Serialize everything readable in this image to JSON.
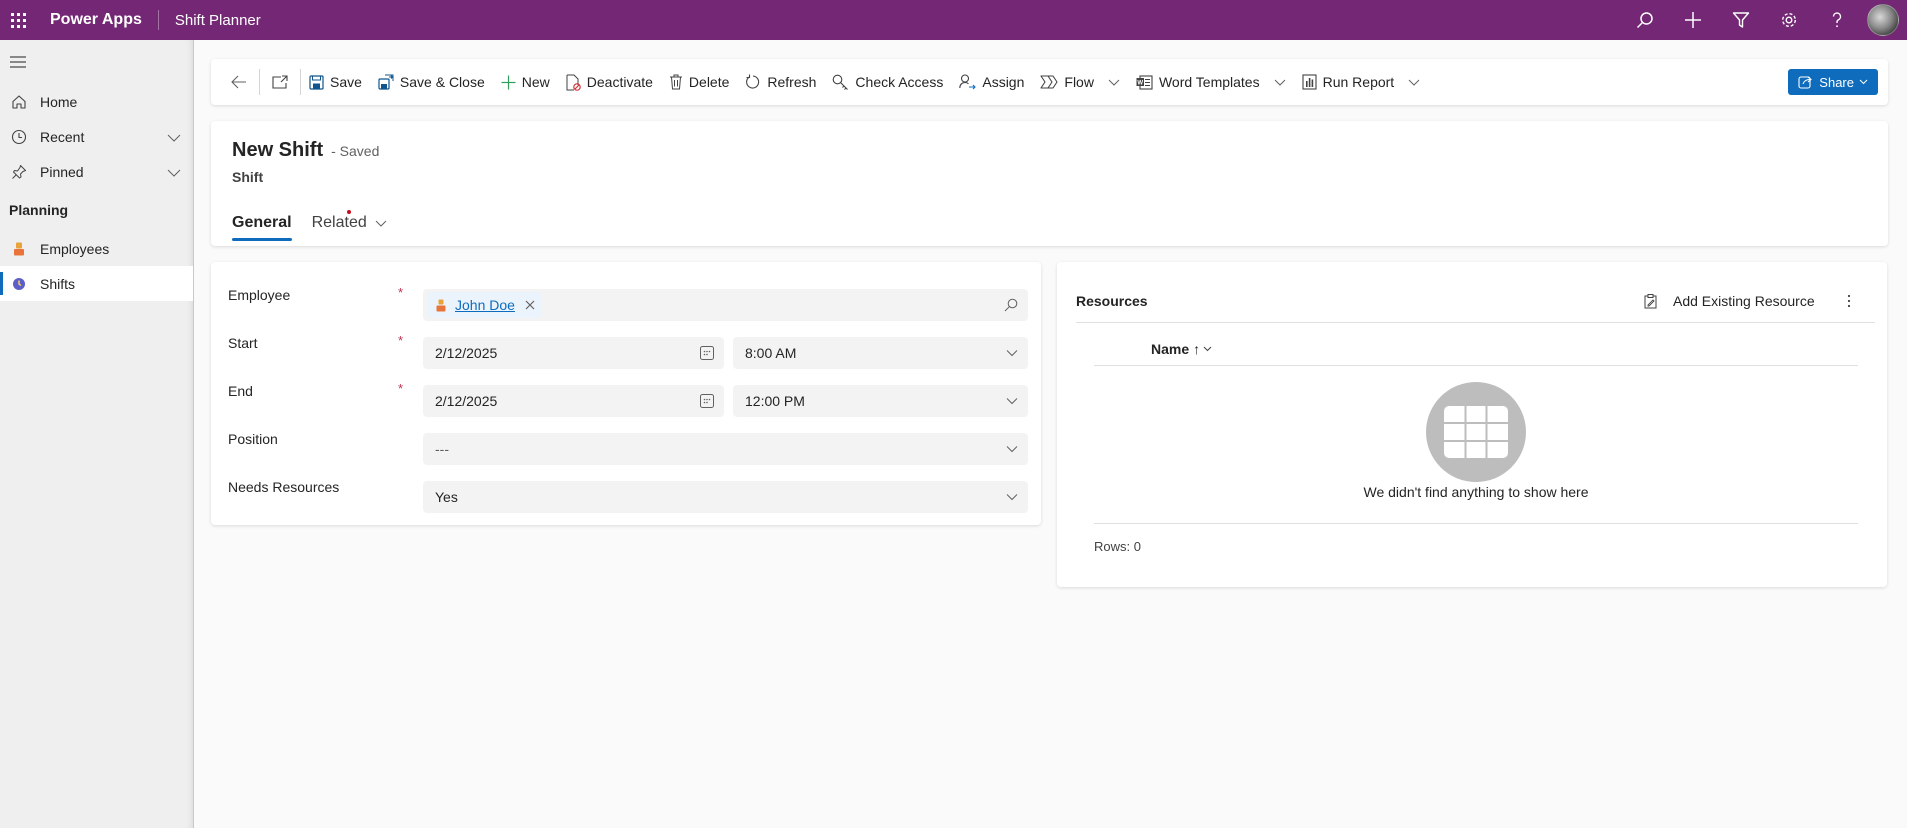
{
  "topbar": {
    "app_name": "Power Apps",
    "app_title": "Shift Planner",
    "icons": [
      "search-icon",
      "plus-icon",
      "filter-icon",
      "settings-icon",
      "help-icon"
    ],
    "brand_color": "#742774"
  },
  "sidebar": {
    "items": [
      {
        "label": "Home",
        "icon": "home-icon"
      },
      {
        "label": "Recent",
        "icon": "clock-icon",
        "expandable": true
      },
      {
        "label": "Pinned",
        "icon": "pin-icon",
        "expandable": true
      }
    ],
    "group_label": "Planning",
    "group_items": [
      {
        "label": "Employees",
        "icon": "employee-icon",
        "selected": false
      },
      {
        "label": "Shifts",
        "icon": "shift-icon",
        "selected": true
      }
    ]
  },
  "commandbar": {
    "back_icon": "back-arrow-icon",
    "popout_icon": "open-in-new-window-icon",
    "commands": [
      {
        "label": "Save",
        "icon": "save-icon"
      },
      {
        "label": "Save & Close",
        "icon": "save-close-icon"
      },
      {
        "label": "New",
        "icon": "plus-icon"
      },
      {
        "label": "Deactivate",
        "icon": "deactivate-icon"
      },
      {
        "label": "Delete",
        "icon": "delete-icon"
      },
      {
        "label": "Refresh",
        "icon": "refresh-icon"
      },
      {
        "label": "Check Access",
        "icon": "key-icon"
      },
      {
        "label": "Assign",
        "icon": "assign-icon"
      },
      {
        "label": "Flow",
        "icon": "flow-icon",
        "dropdown": true
      },
      {
        "label": "Word Templates",
        "icon": "word-icon",
        "dropdown": true
      },
      {
        "label": "Run Report",
        "icon": "report-icon",
        "dropdown": true
      }
    ],
    "share_label": "Share",
    "accent": "#0f6cbd"
  },
  "header": {
    "title": "New Shift",
    "status": "- Saved",
    "entity": "Shift",
    "tabs": [
      {
        "label": "General",
        "active": true
      },
      {
        "label": "Related",
        "active": false,
        "dropdown": true
      }
    ]
  },
  "form": {
    "fields": [
      {
        "label": "Employee",
        "required": true,
        "value": "John Doe",
        "type": "lookup"
      },
      {
        "label": "Start",
        "required": true,
        "date": "2/12/2025",
        "time": "8:00 AM",
        "type": "datetime"
      },
      {
        "label": "End",
        "required": true,
        "date": "2/12/2025",
        "time": "12:00 PM",
        "type": "datetime"
      },
      {
        "label": "Position",
        "required": false,
        "value": "---",
        "type": "select"
      },
      {
        "label": "Needs Resources",
        "required": false,
        "value": "Yes",
        "type": "select"
      }
    ],
    "required_marker": "*"
  },
  "resources": {
    "title": "Resources",
    "add_label": "Add Existing Resource",
    "column_header": "Name",
    "sort_indicator": "↑",
    "empty_message": "We didn't find anything to show here",
    "rows_label": "Rows: 0"
  }
}
